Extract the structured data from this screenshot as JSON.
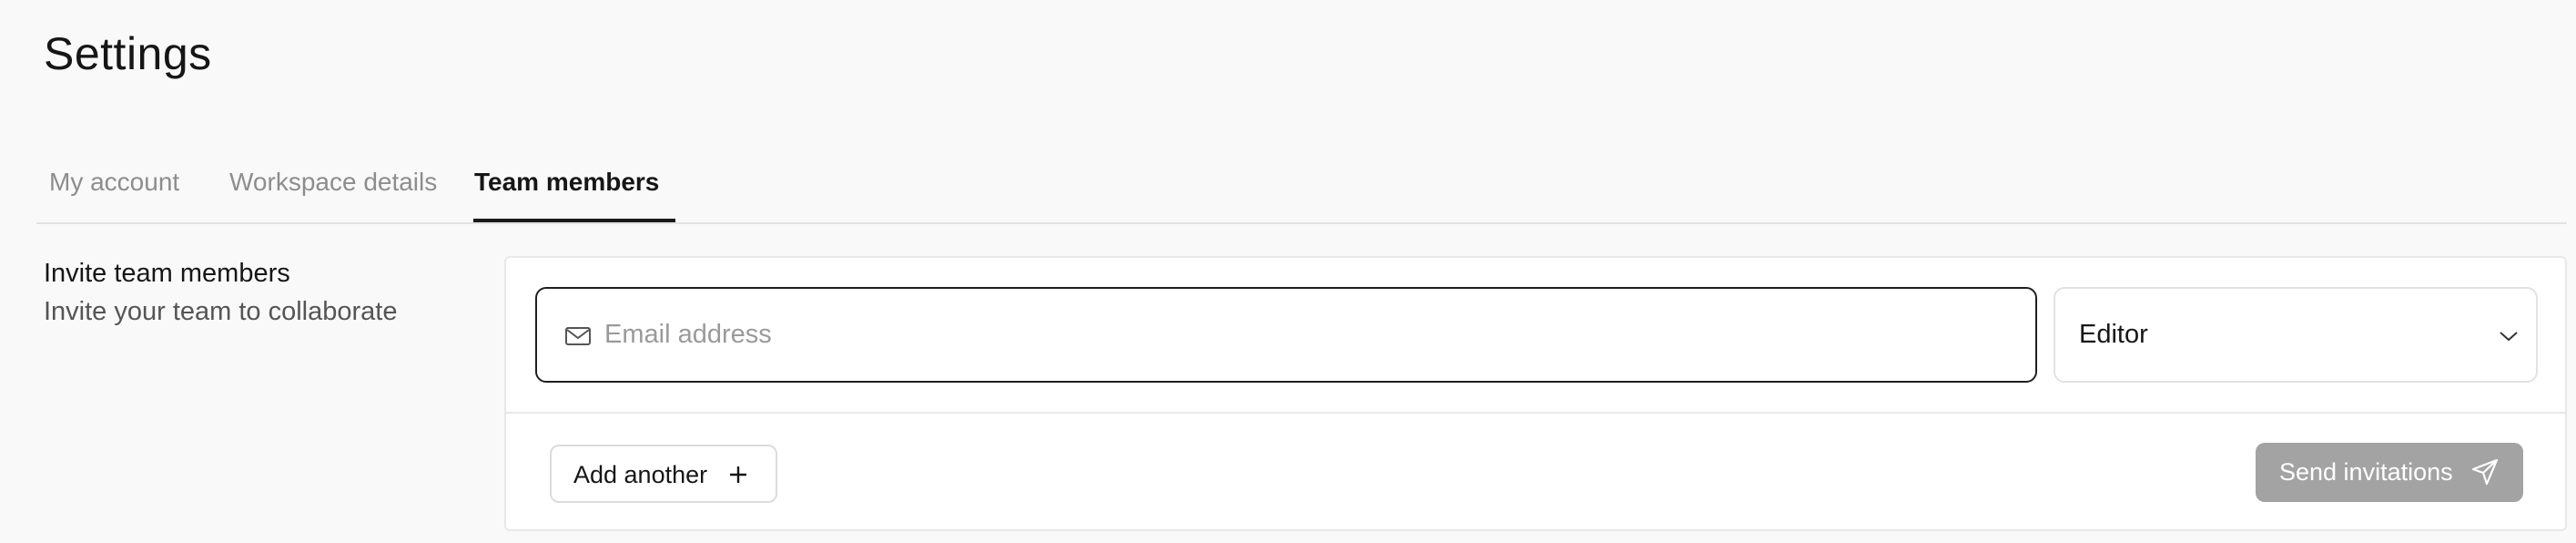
{
  "page": {
    "title": "Settings"
  },
  "tabs": [
    {
      "label": "My account",
      "active": false
    },
    {
      "label": "Workspace details",
      "active": false
    },
    {
      "label": "Team members",
      "active": true
    }
  ],
  "invite": {
    "heading": "Invite team members",
    "subheading": "Invite your team to collaborate",
    "email_placeholder": "Email address",
    "email_value": "",
    "email_icon": "mail-icon",
    "role": {
      "value": "Editor",
      "icon": "chevron-down-icon"
    },
    "add_another_label": "Add another",
    "add_another_icon": "plus-icon",
    "send_label": "Send invitations",
    "send_icon": "send-icon",
    "send_enabled": false
  },
  "colors": {
    "background": "#f9f9f9",
    "text": "#161616",
    "muted_tab": "#8d8d8d",
    "disabled_button": "#a3a3a3"
  }
}
